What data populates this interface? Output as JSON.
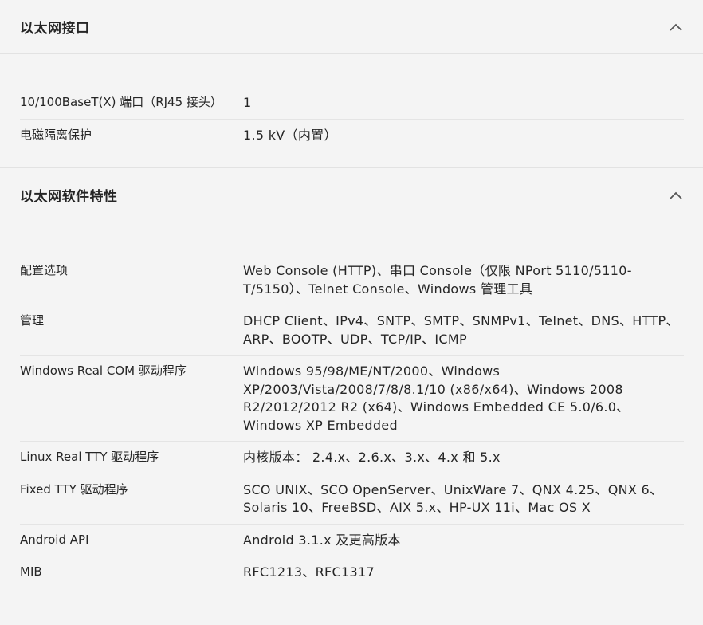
{
  "sections": [
    {
      "title": "以太网接口",
      "rows": [
        {
          "label": "10/100BaseT(X) 端口（RJ45 接头）",
          "value": "1"
        },
        {
          "label": "电磁隔离保护",
          "value": "1.5 kV（内置）"
        }
      ]
    },
    {
      "title": "以太网软件特性",
      "rows": [
        {
          "label": "配置选项",
          "value": "Web Console (HTTP)、串口 Console（仅限 NPort 5110/5110-T/5150）、Telnet Console、Windows 管理工具"
        },
        {
          "label": "管理",
          "value": "DHCP Client、IPv4、SNTP、SMTP、SNMPv1、Telnet、DNS、HTTP、ARP、BOOTP、UDP、TCP/IP、ICMP"
        },
        {
          "label": "Windows Real COM 驱动程序",
          "value": "Windows 95/98/ME/NT/2000、Windows XP/2003/Vista/2008/7/8/8.1/10 (x86/x64)、Windows 2008 R2/2012/2012 R2 (x64)、Windows Embedded CE 5.0/6.0、Windows XP Embedded"
        },
        {
          "label": "Linux Real TTY 驱动程序",
          "value": "内核版本： 2.4.x、2.6.x、3.x、4.x 和 5.x"
        },
        {
          "label": "Fixed TTY 驱动程序",
          "value": "SCO UNIX、SCO OpenServer、UnixWare 7、QNX 4.25、QNX 6、Solaris 10、FreeBSD、AIX 5.x、HP-UX 11i、Mac OS X"
        },
        {
          "label": "Android API",
          "value": "Android 3.1.x 及更高版本"
        },
        {
          "label": "MIB",
          "value": "RFC1213、RFC1317"
        }
      ]
    }
  ],
  "icons": {
    "collapse": "chevron-up-icon"
  }
}
